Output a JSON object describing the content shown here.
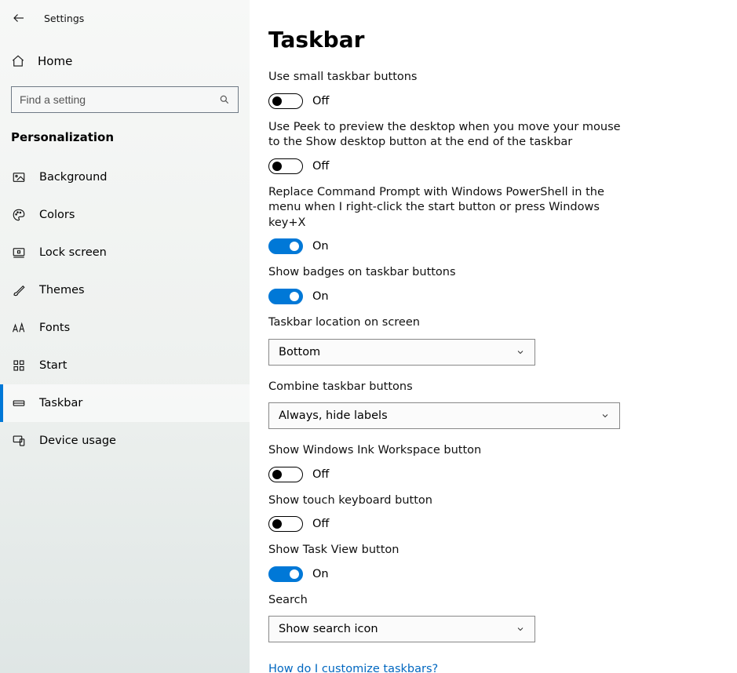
{
  "app_title": "Settings",
  "home_label": "Home",
  "search_placeholder": "Find a setting",
  "section_title": "Personalization",
  "sidebar_items": [
    {
      "label": "Background"
    },
    {
      "label": "Colors"
    },
    {
      "label": "Lock screen"
    },
    {
      "label": "Themes"
    },
    {
      "label": "Fonts"
    },
    {
      "label": "Start"
    },
    {
      "label": "Taskbar"
    },
    {
      "label": "Device usage"
    }
  ],
  "page_title": "Taskbar",
  "settings": {
    "small_buttons": {
      "label": "Use small taskbar buttons",
      "on": false,
      "text": "Off"
    },
    "peek": {
      "label": "Use Peek to preview the desktop when you move your mouse to the Show desktop button at the end of the taskbar",
      "on": false,
      "text": "Off"
    },
    "powershell": {
      "label": "Replace Command Prompt with Windows PowerShell in the menu when I right-click the start button or press Windows key+X",
      "on": true,
      "text": "On"
    },
    "badges": {
      "label": "Show badges on taskbar buttons",
      "on": true,
      "text": "On"
    },
    "location": {
      "label": "Taskbar location on screen",
      "value": "Bottom"
    },
    "combine": {
      "label": "Combine taskbar buttons",
      "value": "Always, hide labels"
    },
    "ink": {
      "label": "Show Windows Ink Workspace button",
      "on": false,
      "text": "Off"
    },
    "touch_kb": {
      "label": "Show touch keyboard button",
      "on": false,
      "text": "Off"
    },
    "task_view": {
      "label": "Show Task View button",
      "on": true,
      "text": "On"
    },
    "search": {
      "label": "Search",
      "value": "Show search icon"
    }
  },
  "help_link": "How do I customize taskbars?"
}
